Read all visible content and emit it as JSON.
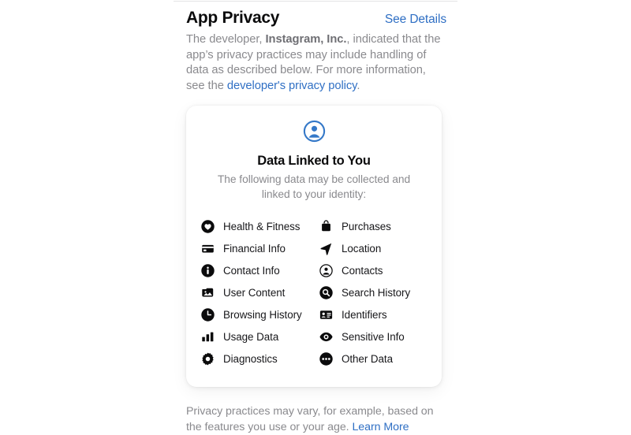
{
  "header": {
    "title": "App Privacy",
    "see_details_label": "See Details"
  },
  "intro": {
    "text_before_developer": "The developer, ",
    "developer_name": "Instagram, Inc.",
    "text_after_developer": ", indicated that the app’s privacy practices may include handling of data as described below. For more information, see the ",
    "policy_link_label": "developer's privacy policy",
    "text_end": "."
  },
  "card": {
    "icon": "person-circle-icon",
    "title": "Data Linked to You",
    "subtitle": "The following data may be collected and linked to your identity:",
    "items": [
      {
        "label": "Health & Fitness",
        "icon": "heart-icon"
      },
      {
        "label": "Purchases",
        "icon": "bag-icon"
      },
      {
        "label": "Financial Info",
        "icon": "credit-card-icon"
      },
      {
        "label": "Location",
        "icon": "location-arrow-icon"
      },
      {
        "label": "Contact Info",
        "icon": "info-circle-icon"
      },
      {
        "label": "Contacts",
        "icon": "person-circle-outline-icon"
      },
      {
        "label": "User Content",
        "icon": "photo-icon"
      },
      {
        "label": "Search History",
        "icon": "magnifier-circle-icon"
      },
      {
        "label": "Browsing History",
        "icon": "clock-icon"
      },
      {
        "label": "Identifiers",
        "icon": "id-card-icon"
      },
      {
        "label": "Usage Data",
        "icon": "bar-chart-icon"
      },
      {
        "label": "Sensitive Info",
        "icon": "eye-icon"
      },
      {
        "label": "Diagnostics",
        "icon": "gear-icon"
      },
      {
        "label": "Other Data",
        "icon": "ellipsis-circle-icon"
      }
    ]
  },
  "footer": {
    "text": "Privacy practices may vary, for example, based on the features you use or your age. ",
    "learn_more_label": "Learn More"
  },
  "colors": {
    "link": "#2f6fc4",
    "accent_icon": "#2f6fc4",
    "muted_text": "#8a8a8e",
    "primary_text": "#0b0b0c",
    "card_background": "#ffffff",
    "page_background": "#ffffff",
    "divider": "#e3e3e5"
  }
}
